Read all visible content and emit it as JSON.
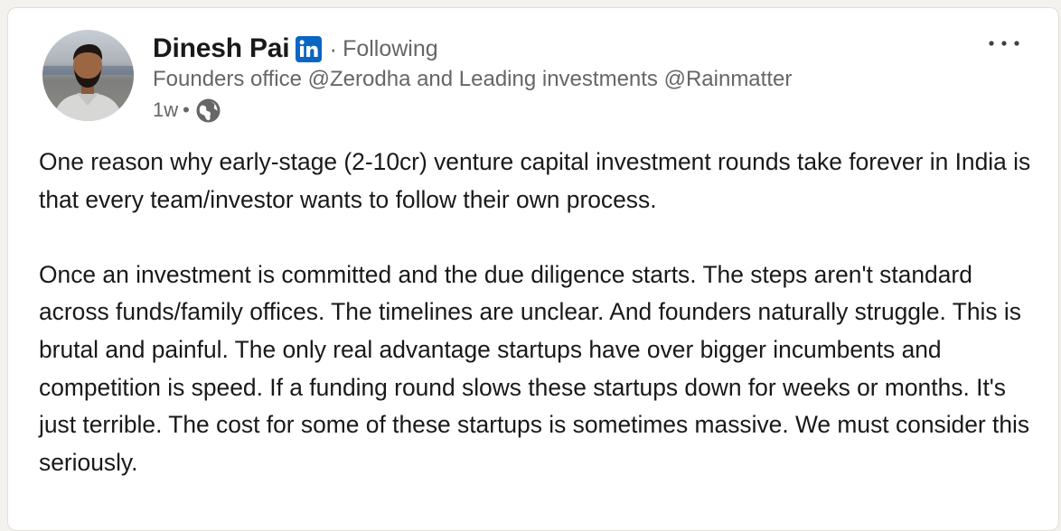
{
  "post": {
    "author": {
      "name": "Dinesh Pai",
      "follow_status": "Following",
      "headline": "Founders office @Zerodha and Leading investments @Rainmatter"
    },
    "meta": {
      "age": "1w",
      "visibility_icon": "globe-icon"
    },
    "badge_icon": "linkedin-icon",
    "menu_icon": "more-horizontal-icon",
    "paragraphs": [
      "One reason why early-stage (2-10cr) venture capital investment rounds take forever in India is that every team/investor wants to follow their own process.",
      "Once an investment is committed and the due diligence starts. The steps aren't standard across funds/family offices. The timelines are unclear. And founders naturally struggle. This is brutal and painful. The only real advantage startups have over bigger incumbents and competition is speed. If a funding round slows these startups down for weeks or months. It's just terrible. The cost for some of these startups is sometimes massive. We must consider this seriously."
    ]
  },
  "colors": {
    "linkedin_blue": "#0a66c2",
    "secondary_text": "#666666",
    "primary_text": "#191919",
    "card_border": "#e0dfdc",
    "page_background": "#f3f2ef"
  }
}
